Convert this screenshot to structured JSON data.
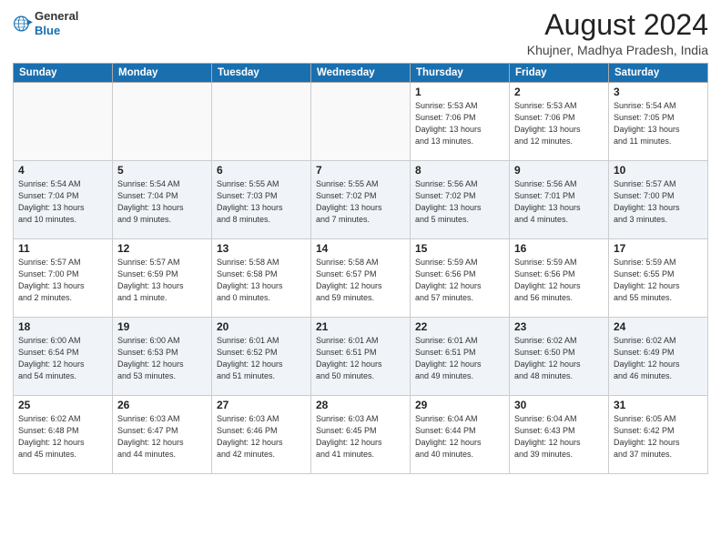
{
  "header": {
    "logo_line1": "General",
    "logo_line2": "Blue",
    "month": "August 2024",
    "location": "Khujner, Madhya Pradesh, India"
  },
  "weekdays": [
    "Sunday",
    "Monday",
    "Tuesday",
    "Wednesday",
    "Thursday",
    "Friday",
    "Saturday"
  ],
  "weeks": [
    [
      {
        "day": "",
        "info": ""
      },
      {
        "day": "",
        "info": ""
      },
      {
        "day": "",
        "info": ""
      },
      {
        "day": "",
        "info": ""
      },
      {
        "day": "1",
        "info": "Sunrise: 5:53 AM\nSunset: 7:06 PM\nDaylight: 13 hours\nand 13 minutes."
      },
      {
        "day": "2",
        "info": "Sunrise: 5:53 AM\nSunset: 7:06 PM\nDaylight: 13 hours\nand 12 minutes."
      },
      {
        "day": "3",
        "info": "Sunrise: 5:54 AM\nSunset: 7:05 PM\nDaylight: 13 hours\nand 11 minutes."
      }
    ],
    [
      {
        "day": "4",
        "info": "Sunrise: 5:54 AM\nSunset: 7:04 PM\nDaylight: 13 hours\nand 10 minutes."
      },
      {
        "day": "5",
        "info": "Sunrise: 5:54 AM\nSunset: 7:04 PM\nDaylight: 13 hours\nand 9 minutes."
      },
      {
        "day": "6",
        "info": "Sunrise: 5:55 AM\nSunset: 7:03 PM\nDaylight: 13 hours\nand 8 minutes."
      },
      {
        "day": "7",
        "info": "Sunrise: 5:55 AM\nSunset: 7:02 PM\nDaylight: 13 hours\nand 7 minutes."
      },
      {
        "day": "8",
        "info": "Sunrise: 5:56 AM\nSunset: 7:02 PM\nDaylight: 13 hours\nand 5 minutes."
      },
      {
        "day": "9",
        "info": "Sunrise: 5:56 AM\nSunset: 7:01 PM\nDaylight: 13 hours\nand 4 minutes."
      },
      {
        "day": "10",
        "info": "Sunrise: 5:57 AM\nSunset: 7:00 PM\nDaylight: 13 hours\nand 3 minutes."
      }
    ],
    [
      {
        "day": "11",
        "info": "Sunrise: 5:57 AM\nSunset: 7:00 PM\nDaylight: 13 hours\nand 2 minutes."
      },
      {
        "day": "12",
        "info": "Sunrise: 5:57 AM\nSunset: 6:59 PM\nDaylight: 13 hours\nand 1 minute."
      },
      {
        "day": "13",
        "info": "Sunrise: 5:58 AM\nSunset: 6:58 PM\nDaylight: 13 hours\nand 0 minutes."
      },
      {
        "day": "14",
        "info": "Sunrise: 5:58 AM\nSunset: 6:57 PM\nDaylight: 12 hours\nand 59 minutes."
      },
      {
        "day": "15",
        "info": "Sunrise: 5:59 AM\nSunset: 6:56 PM\nDaylight: 12 hours\nand 57 minutes."
      },
      {
        "day": "16",
        "info": "Sunrise: 5:59 AM\nSunset: 6:56 PM\nDaylight: 12 hours\nand 56 minutes."
      },
      {
        "day": "17",
        "info": "Sunrise: 5:59 AM\nSunset: 6:55 PM\nDaylight: 12 hours\nand 55 minutes."
      }
    ],
    [
      {
        "day": "18",
        "info": "Sunrise: 6:00 AM\nSunset: 6:54 PM\nDaylight: 12 hours\nand 54 minutes."
      },
      {
        "day": "19",
        "info": "Sunrise: 6:00 AM\nSunset: 6:53 PM\nDaylight: 12 hours\nand 53 minutes."
      },
      {
        "day": "20",
        "info": "Sunrise: 6:01 AM\nSunset: 6:52 PM\nDaylight: 12 hours\nand 51 minutes."
      },
      {
        "day": "21",
        "info": "Sunrise: 6:01 AM\nSunset: 6:51 PM\nDaylight: 12 hours\nand 50 minutes."
      },
      {
        "day": "22",
        "info": "Sunrise: 6:01 AM\nSunset: 6:51 PM\nDaylight: 12 hours\nand 49 minutes."
      },
      {
        "day": "23",
        "info": "Sunrise: 6:02 AM\nSunset: 6:50 PM\nDaylight: 12 hours\nand 48 minutes."
      },
      {
        "day": "24",
        "info": "Sunrise: 6:02 AM\nSunset: 6:49 PM\nDaylight: 12 hours\nand 46 minutes."
      }
    ],
    [
      {
        "day": "25",
        "info": "Sunrise: 6:02 AM\nSunset: 6:48 PM\nDaylight: 12 hours\nand 45 minutes."
      },
      {
        "day": "26",
        "info": "Sunrise: 6:03 AM\nSunset: 6:47 PM\nDaylight: 12 hours\nand 44 minutes."
      },
      {
        "day": "27",
        "info": "Sunrise: 6:03 AM\nSunset: 6:46 PM\nDaylight: 12 hours\nand 42 minutes."
      },
      {
        "day": "28",
        "info": "Sunrise: 6:03 AM\nSunset: 6:45 PM\nDaylight: 12 hours\nand 41 minutes."
      },
      {
        "day": "29",
        "info": "Sunrise: 6:04 AM\nSunset: 6:44 PM\nDaylight: 12 hours\nand 40 minutes."
      },
      {
        "day": "30",
        "info": "Sunrise: 6:04 AM\nSunset: 6:43 PM\nDaylight: 12 hours\nand 39 minutes."
      },
      {
        "day": "31",
        "info": "Sunrise: 6:05 AM\nSunset: 6:42 PM\nDaylight: 12 hours\nand 37 minutes."
      }
    ]
  ]
}
